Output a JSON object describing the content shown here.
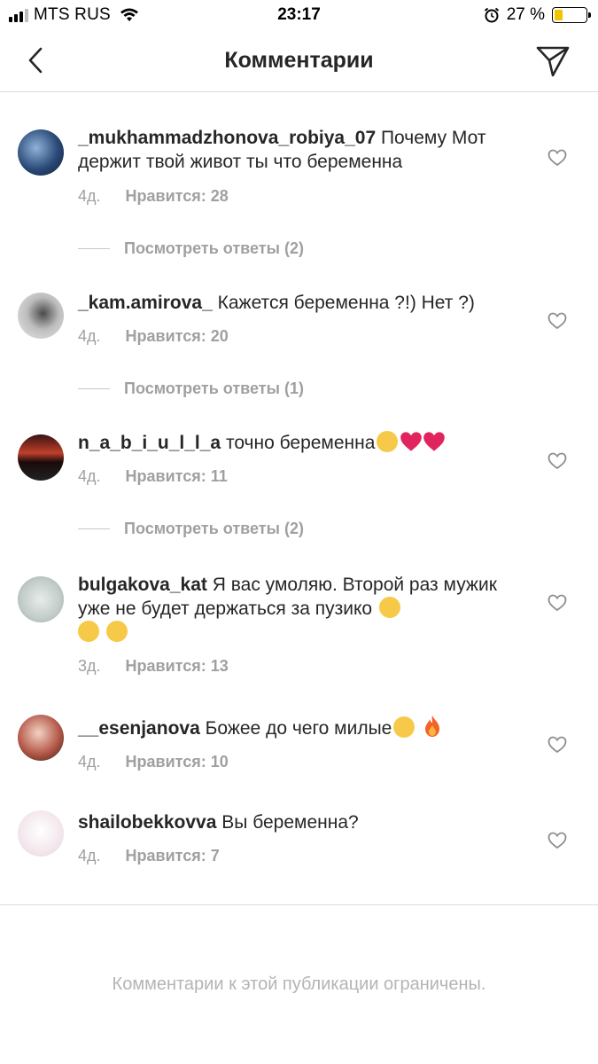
{
  "status_bar": {
    "carrier": "MTS RUS",
    "time": "23:17",
    "battery_percent": "27 %",
    "battery_level": 0.27,
    "signal_icon": "signal-bars-icon",
    "wifi_icon": "wifi-icon",
    "alarm_icon": "alarm-clock-icon"
  },
  "header": {
    "title": "Комментарии",
    "back_icon": "chevron-left-icon",
    "share_icon": "paper-plane-icon"
  },
  "comments": [
    {
      "username": "_mukhammadzhonova_robiya_07",
      "text": " Почему Мот держит твой живот ты что беременна",
      "emojis": [],
      "time": "4д.",
      "likes": "Нравится: 28",
      "replies": "Посмотреть ответы (2)"
    },
    {
      "username": "_kam.amirova_",
      "text": " Кажется беременна ?!) Нет ?)",
      "emojis": [],
      "time": "4д.",
      "likes": "Нравится: 20",
      "replies": "Посмотреть ответы (1)"
    },
    {
      "username": "n_a_b_i_u_l_l_a",
      "text": " точно беременна",
      "emojis": [
        "kissing-face-emoji",
        "red-heart-emoji",
        "red-heart-emoji"
      ],
      "time": "4д.",
      "likes": "Нравится: 11",
      "replies": "Посмотреть ответы (2)"
    },
    {
      "username": "bulgakova_kat",
      "text": " Я вас умоляю. Второй раз мужик уже не будет держаться за пузико",
      "emojis": [
        "tears-of-joy-emoji",
        "tears-of-joy-emoji",
        "tears-of-joy-emoji"
      ],
      "time": "3д.",
      "likes": "Нравится: 13",
      "replies": ""
    },
    {
      "username": "__esenjanova",
      "text": " Божее до чего милые",
      "emojis": [
        "heart-eyes-cat-emoji",
        "fire-emoji"
      ],
      "time": "4д.",
      "likes": "Нравится: 10",
      "replies": ""
    },
    {
      "username": "shailobekkovva",
      "text": " Вы беременна?",
      "emojis": [],
      "time": "4д.",
      "likes": "Нравится: 7",
      "replies": ""
    }
  ],
  "footer": {
    "notice": "Комментарии к этой публикации ограничены."
  },
  "colors": {
    "text": "#262626",
    "secondary": "#8e8e8e",
    "divider": "#dbdbdb",
    "battery_fill": "#f2c400",
    "heart_red": "#e0245e"
  }
}
